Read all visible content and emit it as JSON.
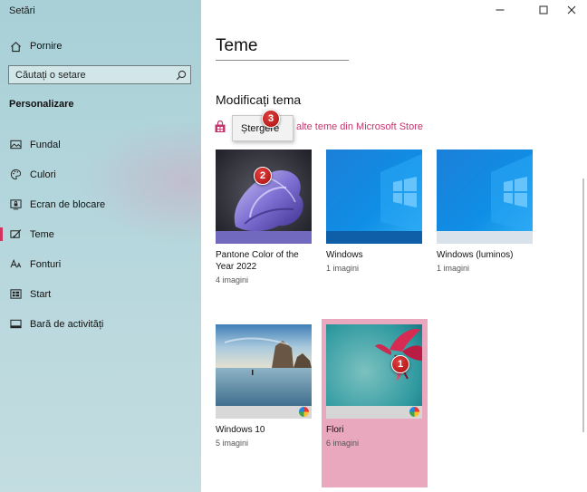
{
  "app": {
    "title": "Setări"
  },
  "sidebar": {
    "home": {
      "label": "Pornire",
      "icon": "home-icon"
    },
    "search": {
      "placeholder": "Căutați o setare",
      "icon": "search-icon"
    },
    "section_title": "Personalizare",
    "items": [
      {
        "label": "Fundal",
        "icon": "image-icon",
        "active": false
      },
      {
        "label": "Culori",
        "icon": "palette-icon",
        "active": false
      },
      {
        "label": "Ecran de blocare",
        "icon": "lock-screen-icon",
        "active": false
      },
      {
        "label": "Teme",
        "icon": "brush-icon",
        "active": true
      },
      {
        "label": "Fonturi",
        "icon": "font-icon",
        "active": false
      },
      {
        "label": "Start",
        "icon": "start-icon",
        "active": false
      },
      {
        "label": "Bară de activități",
        "icon": "taskbar-icon",
        "active": false
      }
    ],
    "accent_color": "#d0345f"
  },
  "window_controls": {
    "minimize": "minimize-icon",
    "maximize": "maximize-icon",
    "close": "close-icon"
  },
  "main": {
    "page_title": "Teme",
    "subtitle": "Modificați tema",
    "store_link": "alte teme din Microsoft Store",
    "store_link_color": "#c4356d",
    "context_menu": {
      "item": "Ștergere"
    },
    "themes": [
      {
        "name": "Pantone Color of the Year 2022",
        "count": "4 imagini",
        "selected": false
      },
      {
        "name": "Windows",
        "count": "1 imagini",
        "selected": false
      },
      {
        "name": "Windows (luminos)",
        "count": "1 imagini",
        "selected": false
      },
      {
        "name": "Windows 10",
        "count": "5 imagini",
        "selected": false
      },
      {
        "name": "Flori",
        "count": "6 imagini",
        "selected": true
      }
    ],
    "selected_color": "#eaa8bf"
  },
  "annotations": [
    "1",
    "2",
    "3"
  ]
}
